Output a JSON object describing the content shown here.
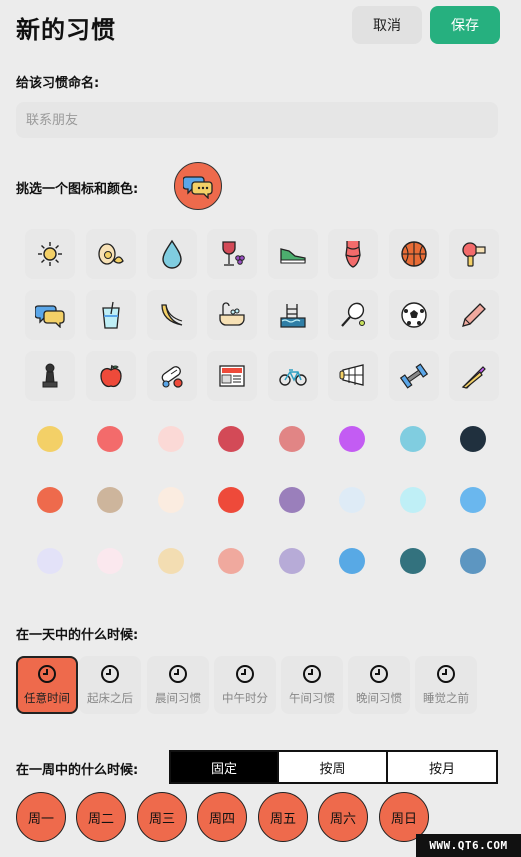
{
  "header": {
    "title": "新的习惯",
    "cancel_label": "取消",
    "save_label": "保存"
  },
  "name_section": {
    "label": "给该习惯命名:",
    "placeholder": "联系朋友"
  },
  "icon_section": {
    "label": "挑选一个图标和颜色:",
    "selected_icon": "chat-bubbles-icon",
    "selected_color": "#ee6a4c"
  },
  "icons": [
    "sun-icon",
    "eggs-icon",
    "water-drop-icon",
    "wine-grapes-icon",
    "sneaker-icon",
    "swimsuit-icon",
    "basketball-icon",
    "hair-dryer-icon",
    "chat-bubbles-icon",
    "drink-cup-icon",
    "banana-icon",
    "bathtub-icon",
    "swimming-pool-icon",
    "tennis-racket-icon",
    "soccer-ball-icon",
    "pencil-icon",
    "chess-pawn-icon",
    "apple-icon",
    "pills-icon",
    "newspaper-icon",
    "bicycle-icon",
    "shuttlecock-icon",
    "dumbbell-icon",
    "hair-straightener-icon"
  ],
  "colors": [
    "#f3d067",
    "#f36b6b",
    "#fbd9d6",
    "#d34a57",
    "#e18585",
    "#c35cf3",
    "#80cde0",
    "#20303e",
    "#ee6a4c",
    "#cdb59c",
    "#fbece0",
    "#ee4a3a",
    "#9a7fbb",
    "#deebf6",
    "#bfeff6",
    "#6ab7ee",
    "#e3e2f8",
    "#fbe8ee",
    "#f3ddb2",
    "#f0a99e",
    "#b7abd7",
    "#58a9e5",
    "#33727e",
    "#5d96c1"
  ],
  "time_section": {
    "label": "在一天中的什么时候:",
    "options": [
      "任意时间",
      "起床之后",
      "晨间习惯",
      "中午时分",
      "午间习惯",
      "晚间习惯",
      "睡觉之前"
    ],
    "selected_index": 0
  },
  "week_section": {
    "label": "在一周中的什么时候:",
    "segments": [
      "固定",
      "按周",
      "按月"
    ],
    "selected_segment": 0,
    "days": [
      "周一",
      "周二",
      "周三",
      "周四",
      "周五",
      "周六",
      "周日"
    ]
  },
  "watermark": "WWW.QT6.COM"
}
